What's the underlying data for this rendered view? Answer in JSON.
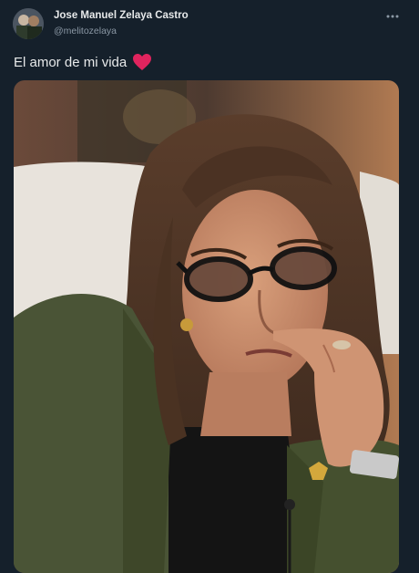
{
  "author": {
    "display_name": "Jose Manuel Zelaya Castro",
    "handle": "@melitozelaya",
    "avatar_icon": "profile-avatar"
  },
  "tweet": {
    "text": "El amor de mi vida",
    "emoji_icon": "red-heart-icon",
    "heart_color": "#e0245e"
  },
  "menu": {
    "icon": "more-horizontal-icon"
  },
  "media": {
    "alt": "photo"
  },
  "colors": {
    "background": "#15202b",
    "primary_text": "#e7e9ea",
    "secondary_text": "#8b98a5"
  }
}
